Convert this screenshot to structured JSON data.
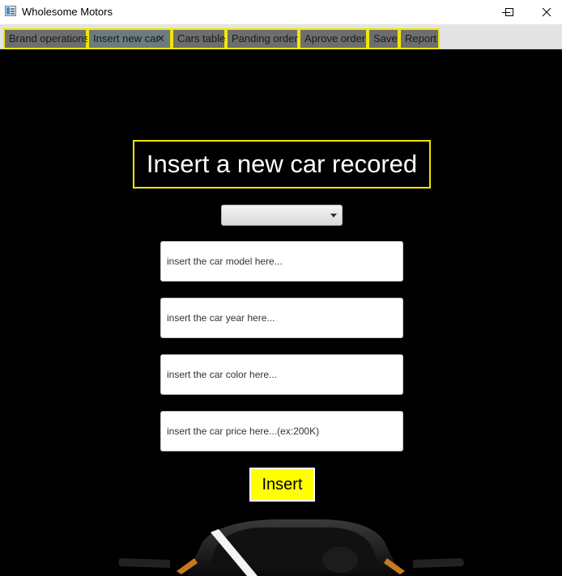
{
  "window": {
    "title": "Wholesome Motors",
    "controls": [
      "minimize-icon",
      "maximize-icon",
      "close-icon"
    ]
  },
  "tabs": [
    {
      "label": "Brand operations",
      "active": false
    },
    {
      "label": "Insert new car",
      "active": true,
      "closable": true
    },
    {
      "label": "Cars table",
      "active": false
    },
    {
      "label": "Panding order",
      "active": false
    },
    {
      "label": "Aprove order",
      "active": false
    },
    {
      "label": "Save",
      "active": false
    },
    {
      "label": "Report",
      "active": false
    }
  ],
  "form": {
    "heading": "Insert a new car recored",
    "brand_select": {
      "selected": ""
    },
    "fields": {
      "model_placeholder": "insert the car model here...",
      "year_placeholder": "insert the car year here...",
      "color_placeholder": "insert the car color here...",
      "price_placeholder": "insert the car price here...(ex:200K)"
    },
    "submit_label": "Insert"
  },
  "colors": {
    "background": "#000000",
    "accent_yellow": "#f2e600",
    "button_yellow": "#ffff00",
    "tab_gray": "#6e6e6e"
  }
}
